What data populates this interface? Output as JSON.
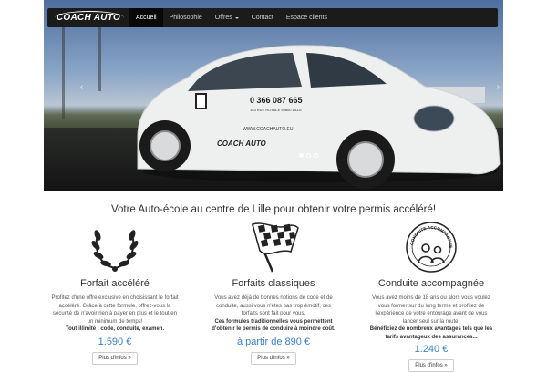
{
  "navbar": {
    "brand": "COACH AUTO",
    "items": [
      {
        "label": "Accueil",
        "active": true
      },
      {
        "label": "Philosophie",
        "active": false
      },
      {
        "label": "Offres",
        "active": false,
        "dropdown": true
      },
      {
        "label": "Contact",
        "active": false
      },
      {
        "label": "Espace clients",
        "active": false
      }
    ]
  },
  "carousel": {
    "car_phone": "0 366 087 665",
    "car_address": "153 RUE ROYALE 59800 LILLE",
    "car_website": "WWW.COACHAUTO.EU",
    "car_brand": "COACH AUTO",
    "prev_icon": "chevron-left-icon",
    "next_icon": "chevron-right-icon",
    "slide_count": 3,
    "active_slide": 1
  },
  "headline": "Votre Auto-école au centre de Lille pour obtenir votre permis accéléré!",
  "offers": [
    {
      "icon": "laurel-wreath-icon",
      "title": "Forfait accéléré",
      "description": "Profitez d'une offre exclusive en choisissant le forfait accéléré. Grâce à cette formule, offrez-vous la sécurité de n'avoir rien à payer en plus et le tout en un minimum de temps!",
      "bold": "Tout illimité : code, conduite, examen.",
      "price": "1.590 €",
      "button": "Plus d'infos »"
    },
    {
      "icon": "checkered-flag-icon",
      "title": "Forfaits classiques",
      "description": "Vous avez déjà de bonnes notions de code et de conduite, aussi vous n'êtes pas trop émotif, ces forfaits sont fait pour vous.",
      "bold": "Ces formules traditionnelles vous permettent d'obtenir le permis de conduire à moindre coût.",
      "price": "à partir de 890 €",
      "button": "Plus d'infos »"
    },
    {
      "icon": "conduite-accompagnee-badge-icon",
      "badge_text": "CONDUITE ACCOMPAGNEE",
      "title": "Conduite accompagnée",
      "description": "Vous avez moins de 18 ans ou alors vous voulez vous former sur du long terme et profitez de l'expérience de votre entourage avant de vous lancer seul sur la route.",
      "bold": "Bénéficiez de nombreux avantages tels que les tarifs avantageux des assurances...",
      "price": "1.240 €",
      "button": "Plus d'infos »"
    }
  ]
}
